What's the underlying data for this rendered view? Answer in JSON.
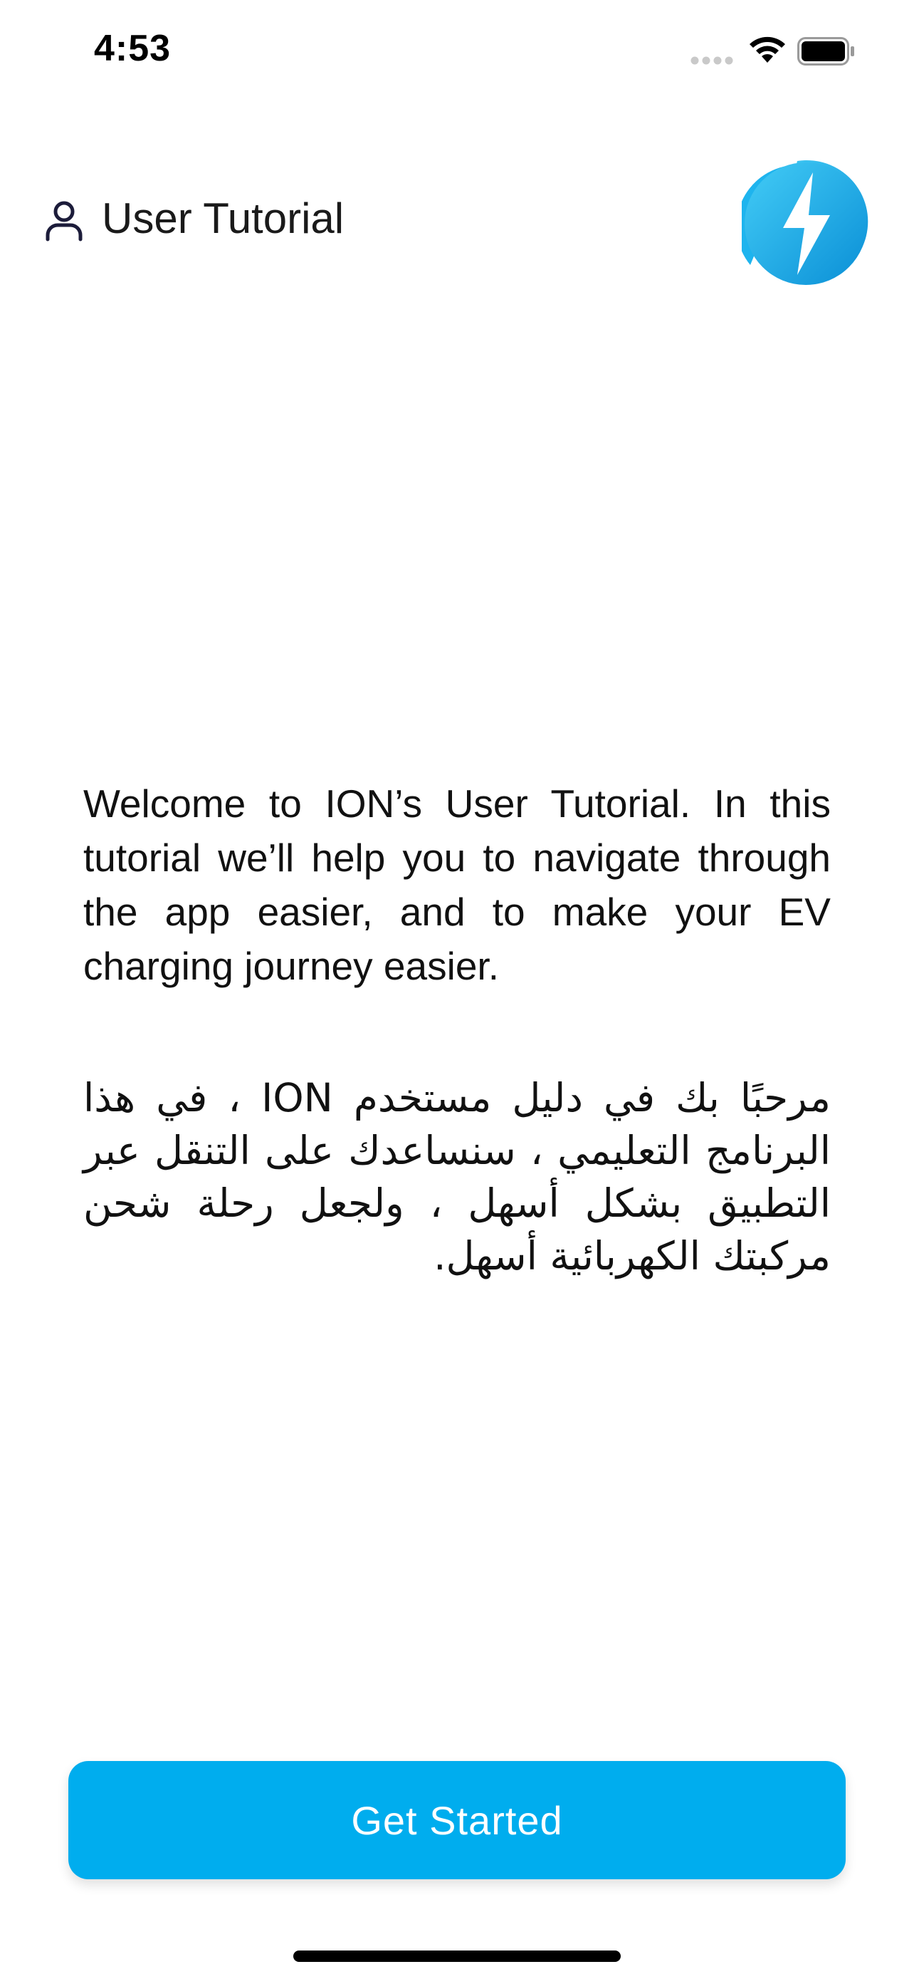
{
  "status_bar": {
    "time": "4:53",
    "icons": [
      "signal-icon",
      "wifi-icon",
      "battery-icon"
    ]
  },
  "header": {
    "title": "User Tutorial",
    "icon": "user-icon",
    "logo": "ion-lightning-logo"
  },
  "content": {
    "welcome_en": "Welcome to ION’s User Tutorial. In this tutorial we’ll help you to navigate through the app easier, and to make your EV charging journey easier.",
    "welcome_ar": "مرحبًا بك في دليل مستخدم ION ، في هذا البرنامج التعليمي ، سنساعدك على التنقل عبر التطبيق بشكل أسهل ، ولجعل رحلة شحن مركبتك الكهربائية أسهل."
  },
  "actions": {
    "get_started_label": "Get Started"
  },
  "colors": {
    "accent": "#00ADEE",
    "logo_light": "#38C6F4",
    "logo_dark": "#0A8FD6",
    "text": "#111111",
    "background": "#FFFFFF"
  }
}
